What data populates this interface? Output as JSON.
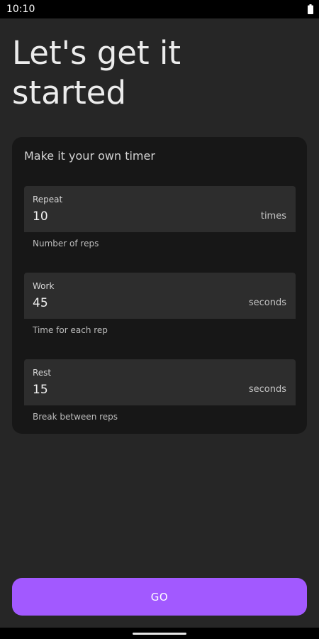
{
  "status_bar": {
    "time": "10:10",
    "battery_icon": "battery-full-icon"
  },
  "page": {
    "title": "Let's get it started"
  },
  "card": {
    "title": "Make it your own timer",
    "fields": [
      {
        "label": "Repeat",
        "value": "10",
        "suffix": "times",
        "helper": "Number of reps"
      },
      {
        "label": "Work",
        "value": "45",
        "suffix": "seconds",
        "helper": "Time for each rep"
      },
      {
        "label": "Rest",
        "value": "15",
        "suffix": "seconds",
        "helper": "Break between reps"
      }
    ]
  },
  "actions": {
    "go_label": "GO"
  },
  "colors": {
    "background": "#262626",
    "card": "#171717",
    "field": "#2d2d2d",
    "accent": "#a259ff"
  }
}
